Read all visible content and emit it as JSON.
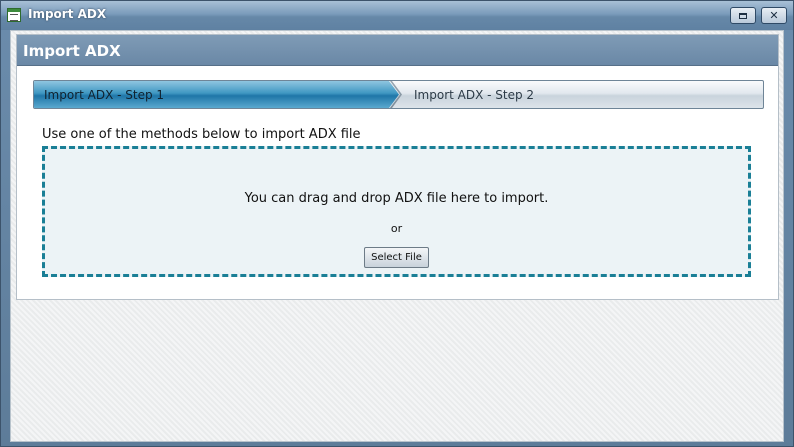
{
  "window": {
    "title": "Import ADX"
  },
  "panel": {
    "title": "Import ADX"
  },
  "wizard": {
    "steps": [
      {
        "label": "Import ADX - Step 1",
        "active": true
      },
      {
        "label": "Import ADX - Step 2",
        "active": false
      }
    ]
  },
  "import": {
    "instructions": "Use one of the methods below to import ADX file",
    "drop_text": "You can drag and drop ADX file here to import.",
    "or_text": "or",
    "select_label": "Select File"
  },
  "colors": {
    "active_step": "#1f76a8",
    "dropzone_border": "#1a7f96",
    "header": "#6a88a6"
  },
  "icons": {
    "app": "app-window-icon",
    "maximize": "maximize-icon",
    "close": "close-icon"
  }
}
